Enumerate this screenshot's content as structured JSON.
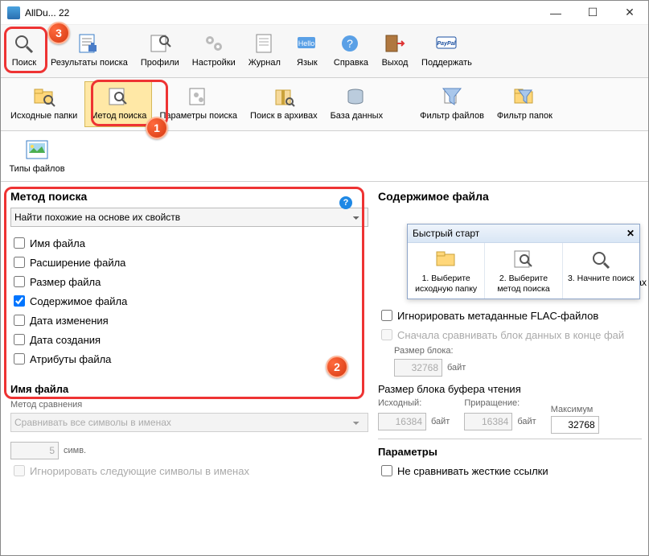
{
  "window": {
    "title": "AllDu...  22"
  },
  "ribbon_top": [
    {
      "key": "search",
      "label": "Поиск"
    },
    {
      "key": "results",
      "label": "Результаты поиска"
    },
    {
      "key": "profiles",
      "label": "Профили"
    },
    {
      "key": "settings",
      "label": "Настройки"
    },
    {
      "key": "journal",
      "label": "Журнал"
    },
    {
      "key": "lang",
      "label": "Язык"
    },
    {
      "key": "help",
      "label": "Справка"
    },
    {
      "key": "exit",
      "label": "Выход"
    },
    {
      "key": "support",
      "label": "Поддержать"
    }
  ],
  "ribbon_sub": [
    {
      "key": "srcfolders",
      "label": "Исходные папки"
    },
    {
      "key": "method",
      "label": "Метод поиска"
    },
    {
      "key": "sparams",
      "label": "Параметры поиска"
    },
    {
      "key": "archives",
      "label": "Поиск в архивах"
    },
    {
      "key": "db",
      "label": "База данных"
    },
    {
      "key": "filefilter",
      "label": "Фильтр файлов"
    },
    {
      "key": "dirfilter",
      "label": "Фильтр папок"
    }
  ],
  "ribbon_extra": {
    "filetypes": "Типы файлов"
  },
  "method_panel": {
    "title": "Метод поиска",
    "combo": "Найти похожие на основе их свойств",
    "checks": [
      {
        "label": "Имя файла",
        "checked": false
      },
      {
        "label": "Расширение файла",
        "checked": false
      },
      {
        "label": "Размер файла",
        "checked": false
      },
      {
        "label": "Содержимое файла",
        "checked": true
      },
      {
        "label": "Дата изменения",
        "checked": false
      },
      {
        "label": "Дата создания",
        "checked": false
      },
      {
        "label": "Атрибуты файла",
        "checked": false
      }
    ],
    "filename_title": "Имя файла",
    "compare_method_label": "Метод сравнения",
    "compare_combo": "Сравнивать все символы в именах",
    "chars_value": "5",
    "chars_suffix": "симв.",
    "ignore_label": "Игнорировать следующие символы в именах"
  },
  "content_panel": {
    "title": "Содержимое файла",
    "ignore_flac": "Игнорировать метаданные FLAC-файлов",
    "tail_option": "Сначала сравнивать блок данных в конце фай",
    "block_size_label": "Размер блока:",
    "block_size_value": "32768",
    "byte_suffix": "байт",
    "read_buffer_title": "Размер блока буфера чтения",
    "src_label": "Исходный:",
    "inc_label": "Приращение:",
    "max_label": "Максимум",
    "src_value": "16384",
    "inc_value": "16384",
    "max_value": "32768",
    "params_title": "Параметры",
    "hardlinks": "Не сравнивать жесткие ссылки",
    "files_suffix": "файлах"
  },
  "quickstart": {
    "title": "Быстрый старт",
    "steps": [
      "1. Выберите исходную папку",
      "2. Выберите метод поиска",
      "3. Начните поиск"
    ]
  }
}
